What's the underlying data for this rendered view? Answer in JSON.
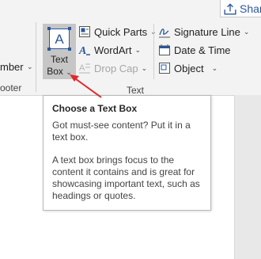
{
  "share": {
    "label": "Share"
  },
  "left_fragments": {
    "numbers_label": "mber",
    "footer_label": "ooter"
  },
  "insert_text": {
    "textbox": {
      "line1": "Text",
      "line2": "Box",
      "icon_letter": "A"
    },
    "quick_parts": {
      "label": "Quick Parts"
    },
    "wordart": {
      "label": "WordArt"
    },
    "drop_cap": {
      "label": "Drop Cap"
    },
    "signature_line": {
      "label": "Signature Line"
    },
    "date_time": {
      "label": "Date & Time"
    },
    "object": {
      "label": "Object"
    },
    "group_label": "Text"
  },
  "tooltip": {
    "title": "Choose a Text Box",
    "paragraph1": "Got must-see content? Put it in a text box.",
    "paragraph2": "A text box brings focus to the content it contains and is great for showcasing important text, such as headings or quotes."
  },
  "colors": {
    "accent": "#2b579a",
    "arrow": "#e0282a",
    "button_selected": "#c6c6c6"
  }
}
